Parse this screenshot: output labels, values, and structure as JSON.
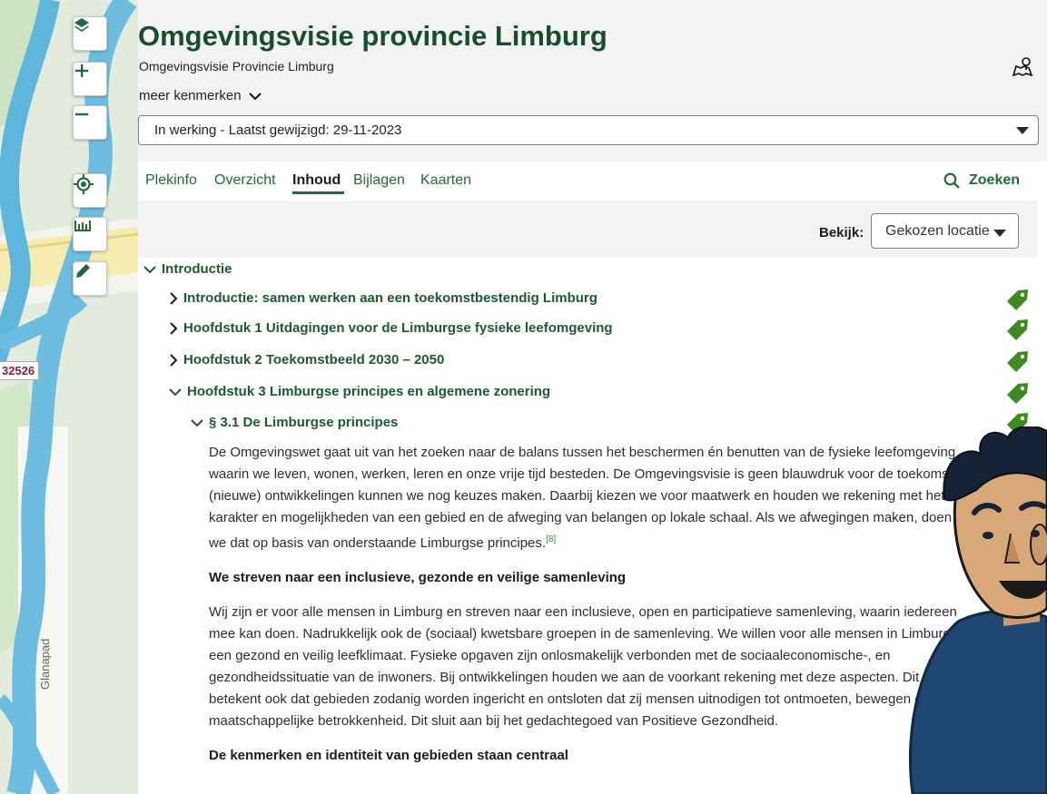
{
  "map": {
    "road_label": "32526",
    "street_label": "Glanapad"
  },
  "header": {
    "title": "Omgevingsvisie provincie Limburg",
    "subtitle": "Omgevingsvisie  Provincie Limburg",
    "meer_kenmerken": "meer kenmerken",
    "version": "In werking - Laatst gewijzigd: 29-11-2023"
  },
  "tabs": [
    {
      "label": "Plekinfo"
    },
    {
      "label": "Overzicht"
    },
    {
      "label": "Inhoud"
    },
    {
      "label": "Bijlagen"
    },
    {
      "label": "Kaarten"
    }
  ],
  "search_label": "Zoeken",
  "toolbar": {
    "bekijk_label": "Bekijk:",
    "bekijk_value": "Gekozen locatie"
  },
  "tree": [
    {
      "label": "Introductie"
    },
    {
      "label": "Introductie: samen werken aan een toekomstbestendig Limburg"
    },
    {
      "label": "Hoofdstuk 1 Uitdagingen voor de Limburgse fysieke leefomgeving"
    },
    {
      "label": "Hoofdstuk 2 Toekomstbeeld 2030 – 2050"
    },
    {
      "label": "Hoofdstuk 3 Limburgse principes en algemene zonering"
    },
    {
      "label": "§ 3.1 De Limburgse principes"
    }
  ],
  "content": {
    "p1": [
      "De Omgevingswet gaat uit van het zoeken naar de balans tussen het beschermen én benutten van de fysieke leefomgeving",
      "waarin we leven, wonen, werken, leren en onze vrije tijd besteden. De Omgevingsvisie is geen blauwdruk voor de toekomst;",
      "(nieuwe) ontwikkelingen kunnen we nog keuzes maken. Daarbij kiezen we voor maatwerk en houden we rekening met het",
      "karakter en mogelijkheden van een gebied en de afweging van belangen op lokale schaal. Als we afwegingen maken, doen",
      "we dat op basis van onderstaande Limburgse principes."
    ],
    "footnote": "[8]",
    "h1": "We streven naar een inclusieve, gezonde en veilige samenleving",
    "p2": [
      "Wij zijn er voor alle mensen in Limburg en streven naar een inclusieve, open en participatieve samenleving, waarin iedereen",
      "mee kan doen. Nadrukkelijk ook de (sociaal) kwetsbare groepen in de samenleving. We willen voor alle mensen in Limburg",
      "een gezond en veilig leefklimaat. Fysieke opgaven zijn onlosmakelijk verbonden met de sociaaleconomische-, en",
      "gezondheidssituatie van de inwoners. Bij ontwikkelingen houden we aan de voorkant rekening met deze aspecten. Dit",
      "betekent ook dat gebieden zodanig worden ingericht en ontsloten dat zij mensen uitnodigen tot ontmoeten, bewegen en",
      "maatschappelijke betrokkenheid. Dit sluit aan bij het gedachtegoed van Positieve Gezondheid."
    ],
    "h2": "De kenmerken en identiteit van gebieden staan centraal"
  },
  "colors": {
    "brand_green": "#154f2b",
    "link_green": "#1f6b3a",
    "tag_green": "#3f8a1f"
  }
}
